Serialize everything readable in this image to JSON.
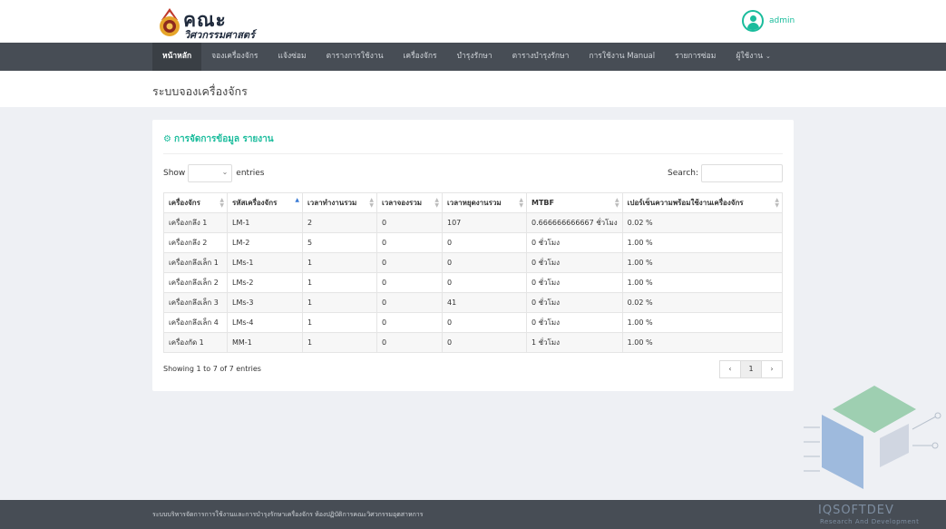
{
  "brand": {
    "title": "คณะ",
    "subtitle": "วิศวกรรมศาสตร์"
  },
  "user": {
    "name": "admin",
    "icon": "user-circle-icon"
  },
  "nav": {
    "items": [
      {
        "label": "หน้าหลัก",
        "active": true
      },
      {
        "label": "จองเครื่องจักร"
      },
      {
        "label": "แจ้งซ่อม"
      },
      {
        "label": "ตารางการใช้งาน"
      },
      {
        "label": "เครื่องจักร"
      },
      {
        "label": "บำรุงรักษา"
      },
      {
        "label": "ตารางบำรุงรักษา"
      },
      {
        "label": "การใช้งาน Manual"
      },
      {
        "label": "รายการซ่อม"
      },
      {
        "label": "ผู้ใช้งาน"
      }
    ]
  },
  "page": {
    "title": "ระบบจองเครื่องจักร"
  },
  "card": {
    "title": "การจัดการข้อมูล รายงาน"
  },
  "table_controls": {
    "show_label": "Show",
    "entries_label": "entries",
    "search_label": "Search:"
  },
  "table": {
    "columns": [
      "เครื่องจักร",
      "รหัสเครื่องจักร",
      "เวลาทำงานรวม",
      "เวลาจองรวม",
      "เวลาหยุดงานรวม",
      "MTBF",
      "เปอร์เซ็นความพร้อมใช้งานเครื่องจักร"
    ],
    "rows": [
      [
        "เครื่องกลึง 1",
        "LM-1",
        "2",
        "0",
        "107",
        "0.666666666667 ชั่วโมง",
        "0.02 %"
      ],
      [
        "เครื่องกลึง 2",
        "LM-2",
        "5",
        "0",
        "0",
        "0 ชั่วโมง",
        "1.00 %"
      ],
      [
        "เครื่องกลึงเล็ก 1",
        "LMs-1",
        "1",
        "0",
        "0",
        "0 ชั่วโมง",
        "1.00 %"
      ],
      [
        "เครื่องกลึงเล็ก 2",
        "LMs-2",
        "1",
        "0",
        "0",
        "0 ชั่วโมง",
        "1.00 %"
      ],
      [
        "เครื่องกลึงเล็ก 3",
        "LMs-3",
        "1",
        "0",
        "41",
        "0 ชั่วโมง",
        "0.02 %"
      ],
      [
        "เครื่องกลึงเล็ก 4",
        "LMs-4",
        "1",
        "0",
        "0",
        "0 ชั่วโมง",
        "1.00 %"
      ],
      [
        "เครื่องกัด 1",
        "MM-1",
        "1",
        "0",
        "0",
        "1 ชั่วโมง",
        "1.00 %"
      ]
    ]
  },
  "table_info": "Showing 1 to 7 of 7 entries",
  "pagination": {
    "prev": "‹",
    "current": "1",
    "next": "›"
  },
  "footer": {
    "text": "ระบบบริหารจัดการการใช้งานและการบำรุงรักษาเครื่องจักร ห้องปฏิบัติการคณะวิศวกรรมอุตสาหการ"
  },
  "watermark": {
    "text": "IQSOFTDEV",
    "sub": "Research And Development"
  },
  "colors": {
    "accent": "#1abc9c",
    "navbar": "#474d55",
    "sort_active": "#3a7bd5"
  }
}
